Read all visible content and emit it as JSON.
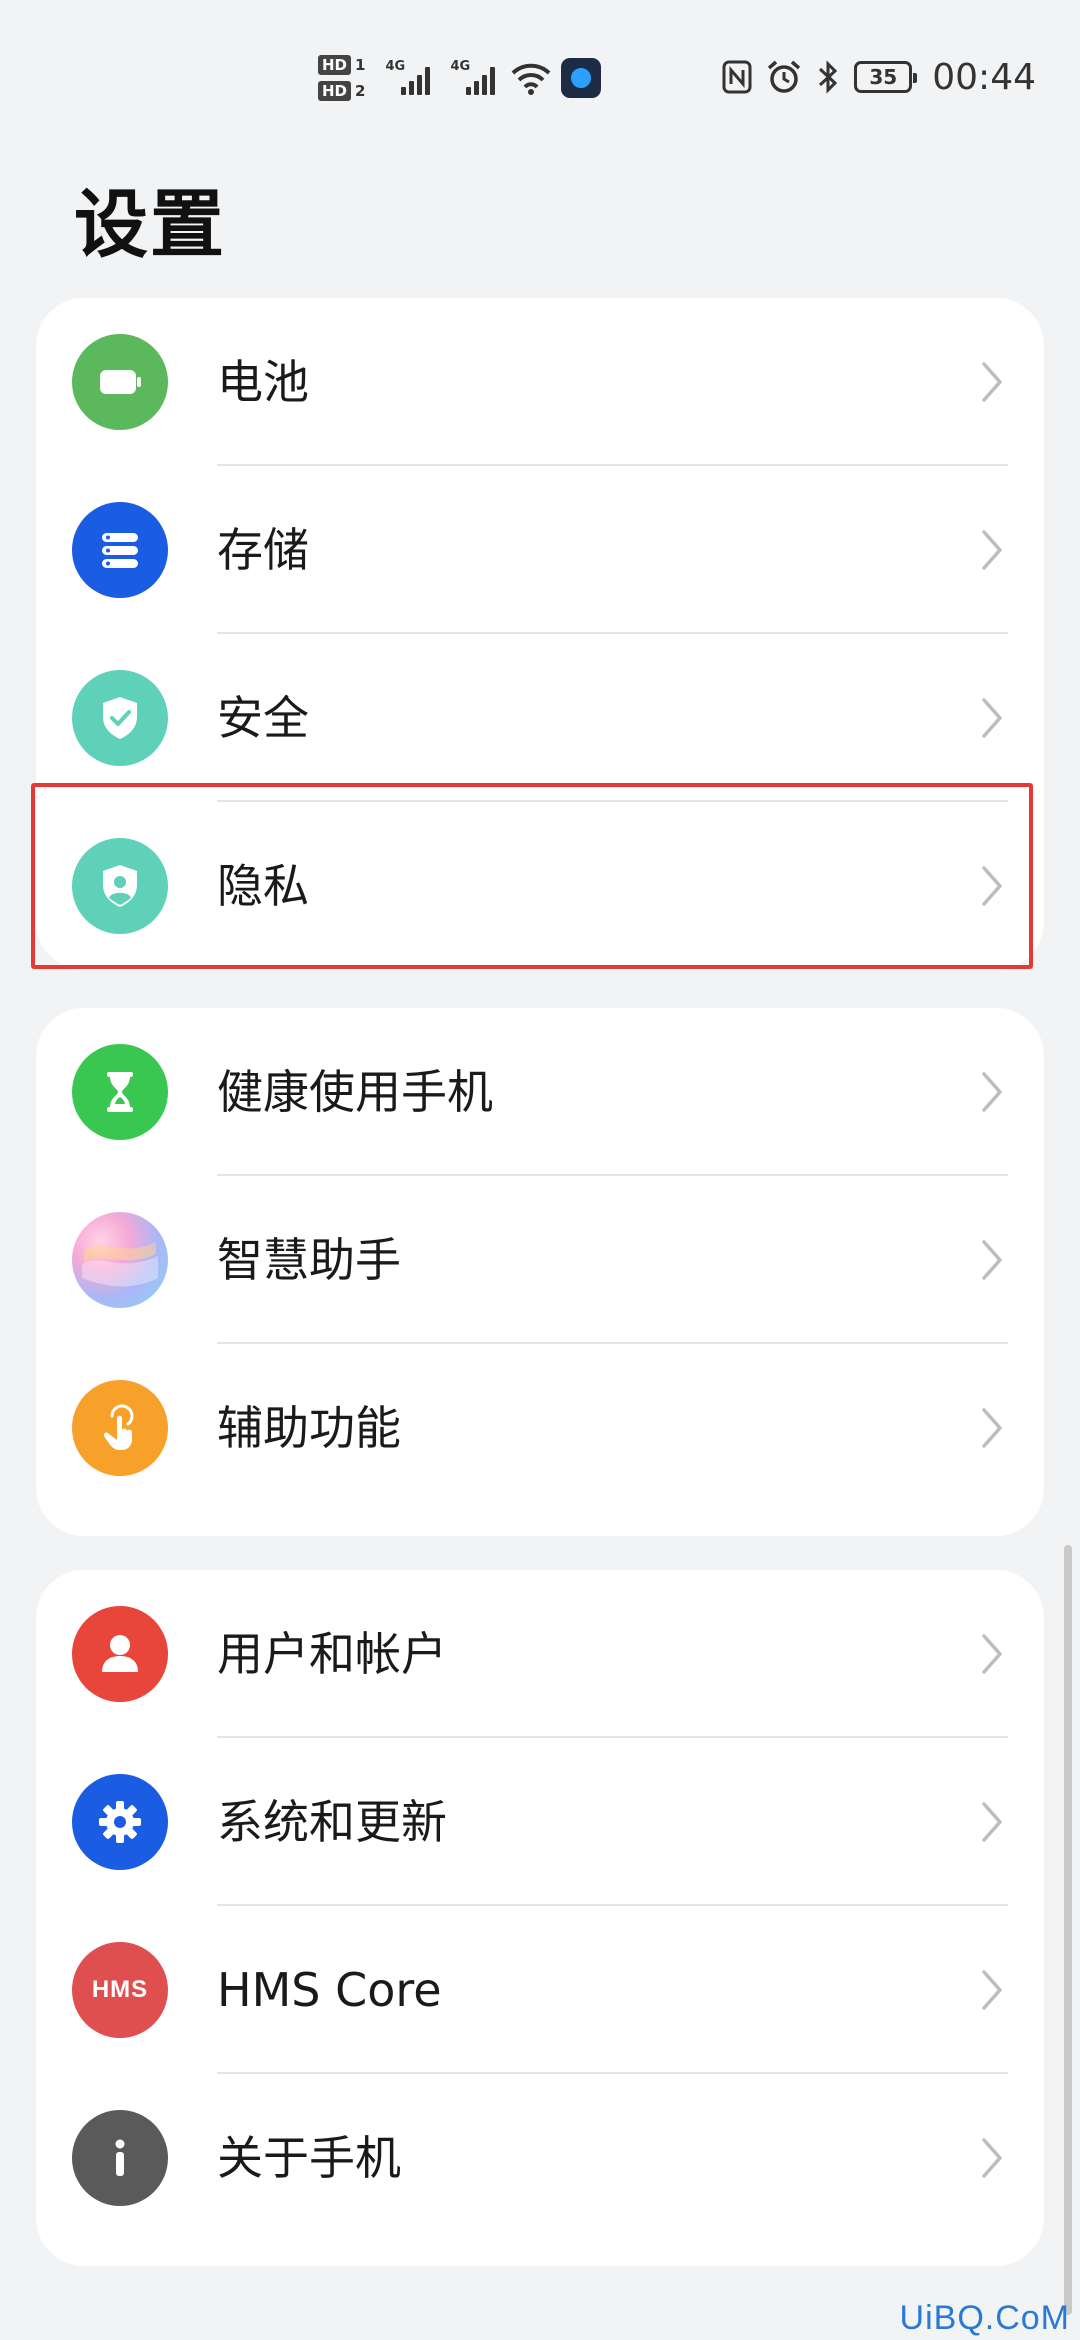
{
  "status_bar": {
    "hd1": "HD",
    "hd1_num": "1",
    "hd2": "HD",
    "hd2_num": "2",
    "net1": "4G",
    "net2": "4G",
    "battery": "35",
    "time": "00:44",
    "icons": [
      "hd-sim-icon",
      "signal-icon",
      "wifi-icon",
      "app-notification-icon",
      "nfc-icon",
      "alarm-icon",
      "bluetooth-icon",
      "battery-icon"
    ]
  },
  "page": {
    "title": "设置"
  },
  "groups": [
    {
      "items": [
        {
          "label": "电池",
          "icon": "battery-icon",
          "color": "#5cb85c"
        },
        {
          "label": "存储",
          "icon": "storage-icon",
          "color": "#1a5de3"
        },
        {
          "label": "安全",
          "icon": "security-shield-icon",
          "color": "#5fd1b9"
        },
        {
          "label": "隐私",
          "icon": "privacy-shield-icon",
          "color": "#5fd1b9",
          "highlighted": true
        }
      ]
    },
    {
      "items": [
        {
          "label": "健康使用手机",
          "icon": "hourglass-icon",
          "color": "#3ac751"
        },
        {
          "label": "智慧助手",
          "icon": "assistant-icon",
          "color": "#b8a6f3"
        },
        {
          "label": "辅助功能",
          "icon": "accessibility-hand-icon",
          "color": "#f7a12b"
        }
      ]
    },
    {
      "items": [
        {
          "label": "用户和帐户",
          "icon": "user-icon",
          "color": "#e9463b"
        },
        {
          "label": "系统和更新",
          "icon": "gear-icon",
          "color": "#1a5de3"
        },
        {
          "label": "HMS Core",
          "icon": "hms-icon",
          "color": "#e04f4f",
          "icon_text": "HMS"
        },
        {
          "label": "关于手机",
          "icon": "info-icon",
          "color": "#5a5a5a"
        }
      ]
    }
  ],
  "highlight_color": "#e53935",
  "watermark": "UiBQ.CoM"
}
